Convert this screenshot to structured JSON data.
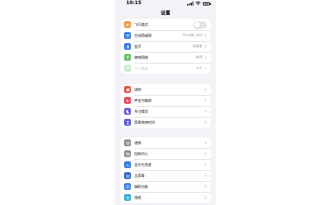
{
  "status": {
    "time": "10:15"
  },
  "header": {
    "title": "设置"
  },
  "groups": {
    "network": {
      "items": [
        {
          "label": "飞行模式",
          "value": "",
          "icon": "airplane-icon",
          "color": "#f19a38",
          "toggle": false
        },
        {
          "label": "无线局域网",
          "value": "TP-LINK_5E0",
          "icon": "wifi-icon",
          "color": "#3478f6"
        },
        {
          "label": "蓝牙",
          "value": "未连接",
          "icon": "bluetooth-icon",
          "color": "#3478f6"
        },
        {
          "label": "蜂窝网络",
          "value": "关闭",
          "icon": "cellular-icon",
          "color": "#65c466"
        },
        {
          "label": "个人热点",
          "value": "关闭",
          "icon": "hotspot-icon",
          "color": "#65c466",
          "disabled": true
        }
      ]
    },
    "notifications": {
      "items": [
        {
          "label": "通知",
          "icon": "notification-icon",
          "color": "#eb4d3d"
        },
        {
          "label": "声音与触感",
          "icon": "sound-icon",
          "color": "#eb445a"
        },
        {
          "label": "专注模式",
          "icon": "moon-icon",
          "color": "#5e5ce6"
        },
        {
          "label": "屏幕使用时间",
          "icon": "hourglass-icon",
          "color": "#5e5ce6"
        }
      ]
    },
    "general": {
      "items": [
        {
          "label": "通用",
          "icon": "gear-icon",
          "color": "#8e8e93"
        },
        {
          "label": "控制中心",
          "icon": "control-center-icon",
          "color": "#8e8e93"
        },
        {
          "label": "显示与亮度",
          "icon": "display-icon",
          "color": "#3478f6"
        },
        {
          "label": "主屏幕",
          "icon": "home-screen-icon",
          "color": "#2c5bd4"
        },
        {
          "label": "辅助功能",
          "icon": "accessibility-icon",
          "color": "#3478f6"
        },
        {
          "label": "墙纸",
          "icon": "wallpaper-icon",
          "color": "#35aadc"
        }
      ]
    }
  }
}
